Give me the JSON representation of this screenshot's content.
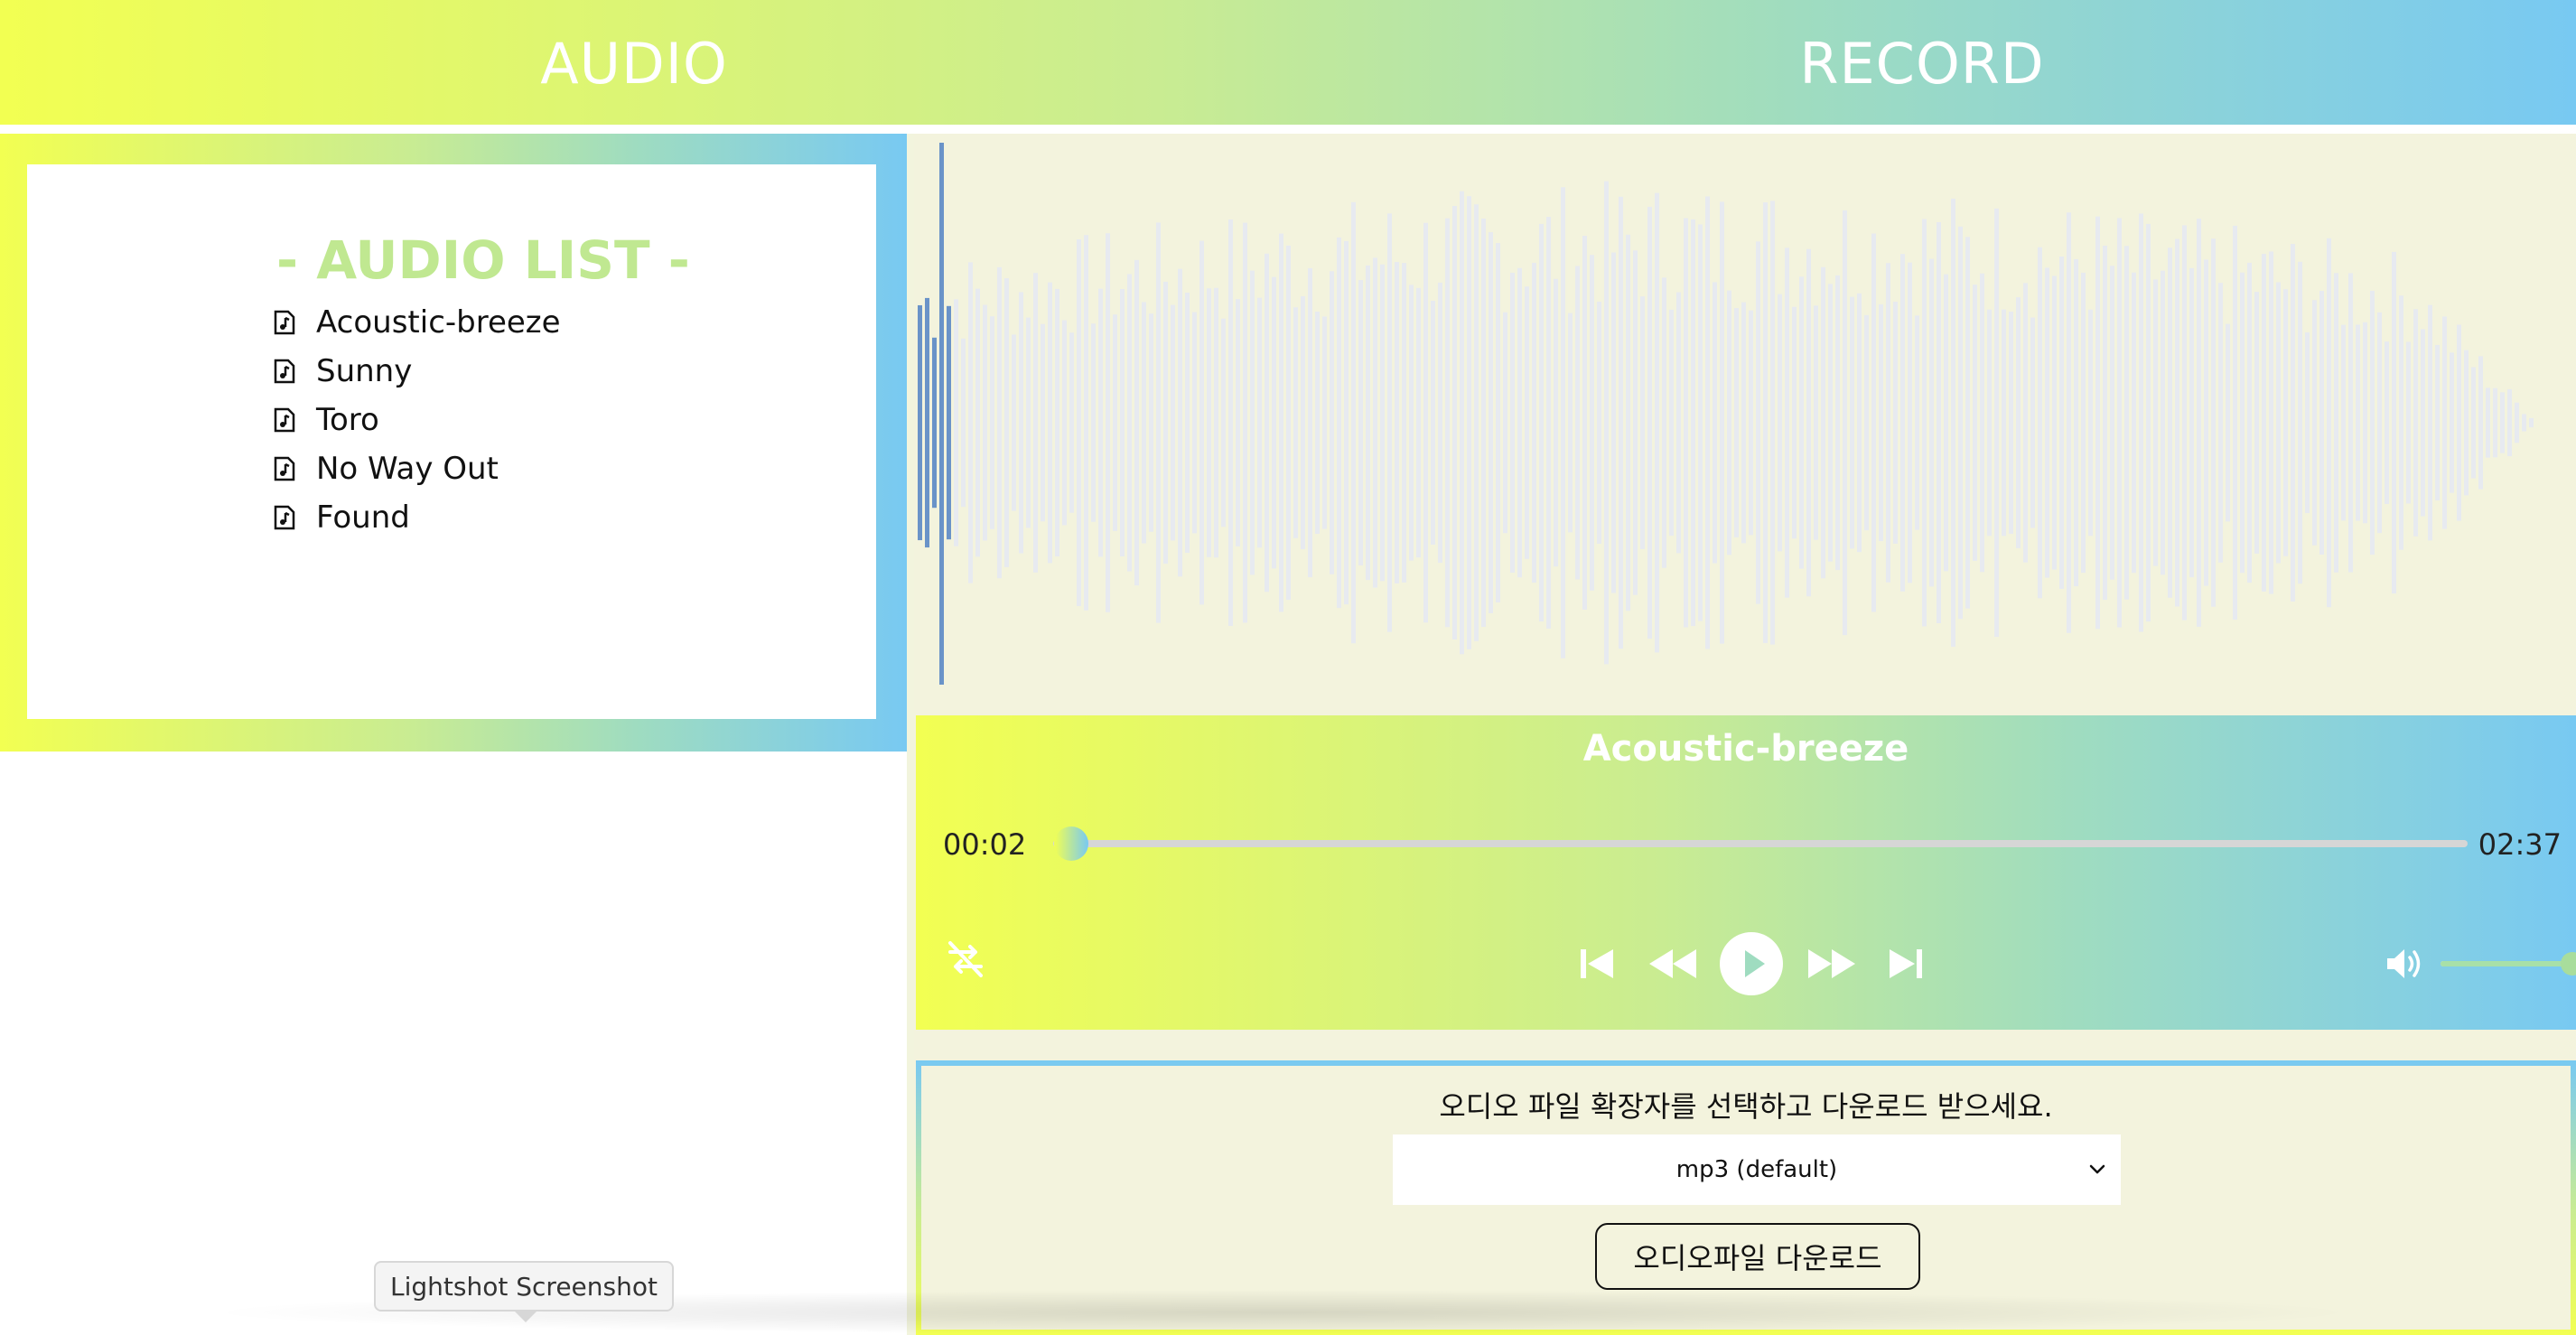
{
  "nav": {
    "tabs": [
      {
        "label": "AUDIO"
      },
      {
        "label": "RECORD"
      }
    ]
  },
  "audio_list": {
    "title": "- AUDIO LIST -",
    "items": [
      "Acoustic-breeze",
      "Sunny",
      "Toro",
      "No Way Out",
      "Found"
    ],
    "item_icon": "music-file-icon"
  },
  "player": {
    "track_title": "Acoustic-breeze",
    "current_time": "00:02",
    "total_time": "02:37",
    "progress": 0.013,
    "volume": 1.0,
    "controls": [
      "repeat-icon",
      "skip-previous-icon",
      "rewind-icon",
      "play-icon",
      "fast-forward-icon",
      "skip-next-icon",
      "volume-icon"
    ]
  },
  "waveform": {
    "played_color": "#6a93c8",
    "unplayed_color": "#e7eaf0",
    "played_fraction": 0.013
  },
  "download": {
    "instruction": "오디오 파일 확장자를 선택하고 다운로드 받으세요.",
    "selected_format": "mp3 (default)",
    "button_label": "오디오파일 다운로드"
  },
  "tooltip": {
    "text": "Lightshot Screenshot"
  },
  "colors": {
    "gradient_start": "#f2ff52",
    "gradient_end": "#78c9f2",
    "panel_bg": "#f3f3dd",
    "title_green": "#c0e891"
  }
}
